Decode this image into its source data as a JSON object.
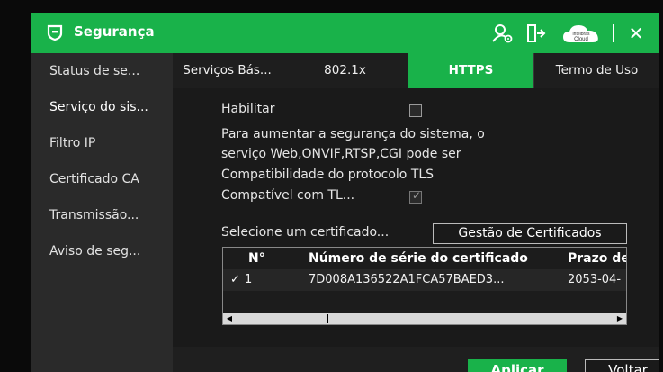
{
  "title": "Segurança",
  "toolbar": {
    "user_icon": "user-settings-icon",
    "logout_icon": "logout-icon",
    "cloud_label": "Cloud",
    "cloud_brand": "intelbras",
    "close_label": "✕"
  },
  "sidebar": {
    "items": [
      {
        "label": "Status de se..."
      },
      {
        "label": "Serviço do sis..."
      },
      {
        "label": "Filtro IP"
      },
      {
        "label": "Certificado CA"
      },
      {
        "label": "Transmissão..."
      },
      {
        "label": "Aviso de seg..."
      }
    ],
    "active_marker": "›"
  },
  "tabs": [
    {
      "label": "Serviços Bás..."
    },
    {
      "label": "802.1x"
    },
    {
      "label": "HTTPS"
    },
    {
      "label": "Termo de Uso"
    }
  ],
  "form": {
    "enable_label": "Habilitar",
    "description_line1": "Para aumentar a segurança do sistema, o",
    "description_line2": "serviço Web,ONVIF,RTSP,CGI pode ser",
    "compat_heading": "Compatibilidade do protocolo TLS",
    "compat_label": "Compatível com TL...",
    "select_cert_label": "Selecione um certificado...",
    "cert_mgmt_button": "Gestão de Certificados"
  },
  "table": {
    "headers": [
      "N°",
      "Número de série do certificado",
      "Prazo de"
    ],
    "rows": [
      {
        "check": "✓",
        "num": "1",
        "serial": "7D008A136522A1FCA57BAED3...",
        "expiry": "2053-04-"
      }
    ]
  },
  "buttons": {
    "apply": "Aplicar",
    "back": "Voltar"
  },
  "colors": {
    "accent": "#19b24a"
  }
}
